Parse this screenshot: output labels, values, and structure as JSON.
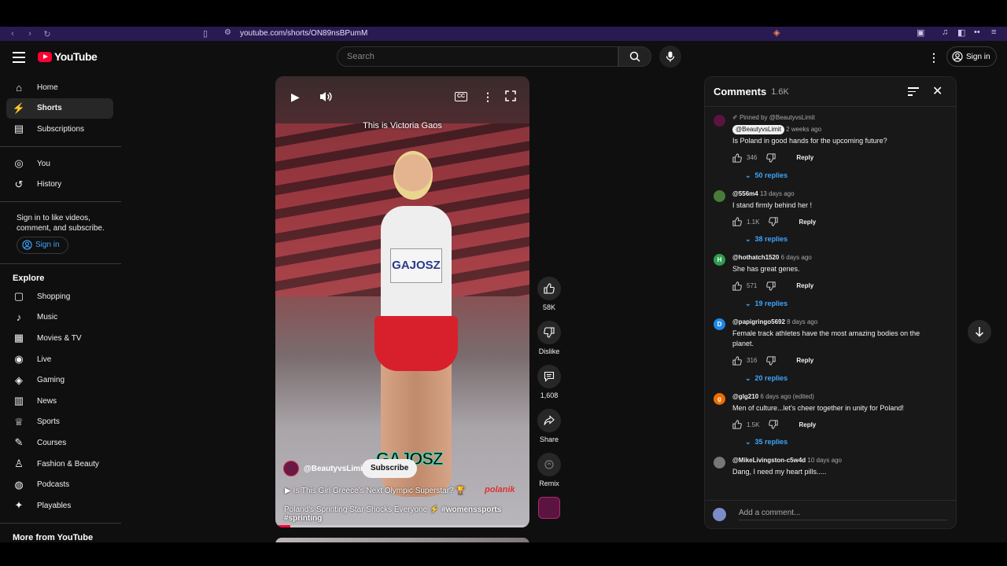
{
  "browser": {
    "url": "youtube.com/shorts/ON89nsBPumM"
  },
  "header": {
    "logo_text": "YouTube",
    "search_placeholder": "Search",
    "signin_label": "Sign in"
  },
  "sidebar": {
    "main": [
      {
        "label": "Home",
        "icon": "home-icon"
      },
      {
        "label": "Shorts",
        "icon": "shorts-icon",
        "active": true
      },
      {
        "label": "Subscriptions",
        "icon": "subscriptions-icon"
      }
    ],
    "you": [
      {
        "label": "You",
        "icon": "user-circle-icon"
      },
      {
        "label": "History",
        "icon": "history-icon"
      }
    ],
    "signin_prompt": "Sign in to like videos, comment, and subscribe.",
    "signin_button": "Sign in",
    "explore_title": "Explore",
    "explore": [
      {
        "label": "Shopping",
        "icon": "shopping-bag-icon"
      },
      {
        "label": "Music",
        "icon": "music-note-icon"
      },
      {
        "label": "Movies & TV",
        "icon": "film-icon"
      },
      {
        "label": "Live",
        "icon": "live-icon"
      },
      {
        "label": "Gaming",
        "icon": "gamepad-icon"
      },
      {
        "label": "News",
        "icon": "news-icon"
      },
      {
        "label": "Sports",
        "icon": "trophy-icon"
      },
      {
        "label": "Courses",
        "icon": "courses-icon"
      },
      {
        "label": "Fashion & Beauty",
        "icon": "hanger-icon"
      },
      {
        "label": "Podcasts",
        "icon": "podcast-icon"
      },
      {
        "label": "Playables",
        "icon": "playables-icon"
      }
    ],
    "more_title": "More from YouTube"
  },
  "video": {
    "caption": "This is Victoria Gaos",
    "bib_text": "GAJOSZ",
    "overlay_name": "GAJOSZ",
    "channel": "@BeautyvsLimit",
    "subscribe_label": "Subscribe",
    "title_line": "Is This Girl Greece’s Next Olympic Superstar? 🏆",
    "description": "Poland’s Sprinting Star Shocks Everyone ⚡",
    "hashtags": "#womenssports #sprinting",
    "brand_mark": "polanik",
    "progress_fraction": 0.06
  },
  "actions": {
    "like_count": "58K",
    "dislike_label": "Dislike",
    "comment_count": "1,608",
    "share_label": "Share",
    "remix_label": "Remix"
  },
  "comments": {
    "title": "Comments",
    "count": "1.6K",
    "add_placeholder": "Add a comment...",
    "pinned_label": "Pinned by @BeautyvsLimit",
    "reply_label": "Reply",
    "items": [
      {
        "author": "@BeautyvsLimit",
        "time": "2 weeks ago",
        "text": "Is Poland in good hands for the upcoming future?",
        "likes": "346",
        "replies": "50 replies",
        "avatar_letter": "",
        "avatar_color": "#5b1440"
      },
      {
        "author": "@556m4",
        "time": "13 days ago",
        "text": "I stand firmly behind her !",
        "likes": "1.1K",
        "replies": "38 replies",
        "avatar_letter": "",
        "avatar_color": "#4a7a3a"
      },
      {
        "author": "@hothatch1520",
        "time": "6 days ago",
        "text": "She has great genes.",
        "likes": "571",
        "replies": "19 replies",
        "avatar_letter": "H",
        "avatar_color": "#2e9e4f"
      },
      {
        "author": "@papigringo5692",
        "time": "8 days ago",
        "text": "Female track athletes have the most amazing bodies on the planet.",
        "likes": "316",
        "replies": "20 replies",
        "avatar_letter": "D",
        "avatar_color": "#1e88e5"
      },
      {
        "author": "@glg210",
        "time": "6 days ago (edited)",
        "text": "Men of culture...let's cheer together in unity for Poland!",
        "likes": "1.5K",
        "replies": "35 replies",
        "avatar_letter": "g",
        "avatar_color": "#ef6c00"
      },
      {
        "author": "@MikeLivingston-c5w4d",
        "time": "10 days ago",
        "text": "Dang, I need my heart pills.....",
        "likes": "",
        "replies": "",
        "avatar_letter": "",
        "avatar_color": "#777777"
      }
    ]
  },
  "colors": {
    "brand_red": "#ff0033",
    "link_blue": "#3ea6ff",
    "background": "#0f0f0f",
    "browser_bar": "#2a1a52"
  }
}
